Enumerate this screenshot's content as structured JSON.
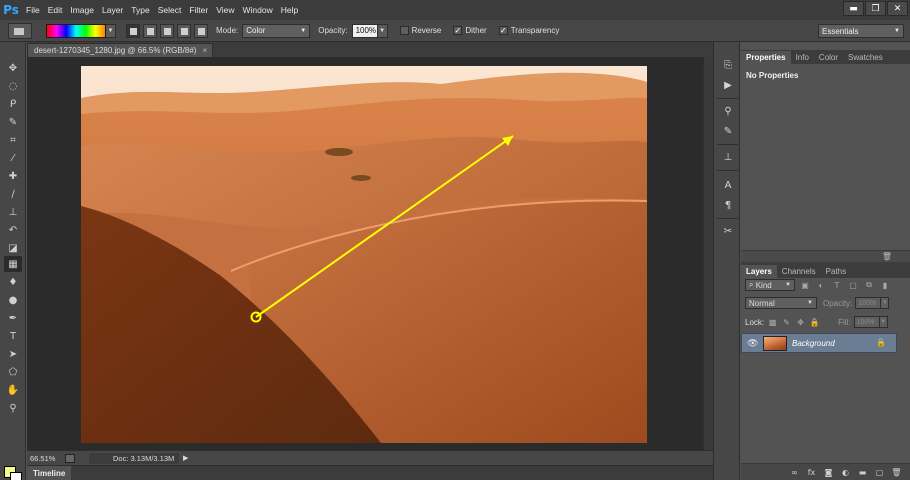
{
  "app": {
    "logo": "Ps"
  },
  "menu": [
    "File",
    "Edit",
    "Image",
    "Layer",
    "Type",
    "Select",
    "Filter",
    "View",
    "Window",
    "Help"
  ],
  "window_controls": {
    "minimize": "▬",
    "restore": "❐",
    "close": "✕"
  },
  "options": {
    "mode_label": "Mode:",
    "mode_value": "Color",
    "opacity_label": "Opacity:",
    "opacity_value": "100%",
    "reverse_label": "Reverse",
    "reverse_checked": false,
    "dither_label": "Dither",
    "dither_checked": true,
    "transparency_label": "Transparency",
    "transparency_checked": true,
    "workspace": "Essentials"
  },
  "document": {
    "tab_title": "desert-1270345_1280.jpg @ 66.5% (RGB/8#)",
    "close": "×"
  },
  "status": {
    "zoom": "66.51%",
    "doc_info": "Doc: 3.13M/3.13M",
    "arrow": "▶"
  },
  "timeline": {
    "label": "Timeline"
  },
  "properties_panel": {
    "tabs": [
      "Properties",
      "Info",
      "Color",
      "Swatches"
    ],
    "active_tab": "Properties",
    "body": "No Properties"
  },
  "layers_panel": {
    "tabs": [
      "Layers",
      "Channels",
      "Paths"
    ],
    "active_tab": "Layers",
    "filter_kind": "Kind",
    "blend_mode": "Normal",
    "opacity_label": "Opacity:",
    "opacity_value": "100%",
    "lock_label": "Lock:",
    "fill_label": "Fill:",
    "fill_value": "100%",
    "layers": [
      {
        "name": "Background",
        "visible": true,
        "locked": true,
        "selected": true
      }
    ]
  },
  "colors": {
    "foreground": "#f2ff8a",
    "background": "#ffffff",
    "gradient_line": "#ffff00",
    "layer_selected": "#6a7d93"
  },
  "tools": [
    "move-icon",
    "marquee-icon",
    "lasso-icon",
    "quick-select-icon",
    "crop-icon",
    "eyedropper-icon",
    "healing-icon",
    "brush-icon",
    "clone-stamp-icon",
    "history-brush-icon",
    "eraser-icon",
    "gradient-icon",
    "blur-icon",
    "dodge-icon",
    "pen-icon",
    "type-icon",
    "path-select-icon",
    "shape-icon",
    "hand-icon",
    "zoom-icon"
  ]
}
